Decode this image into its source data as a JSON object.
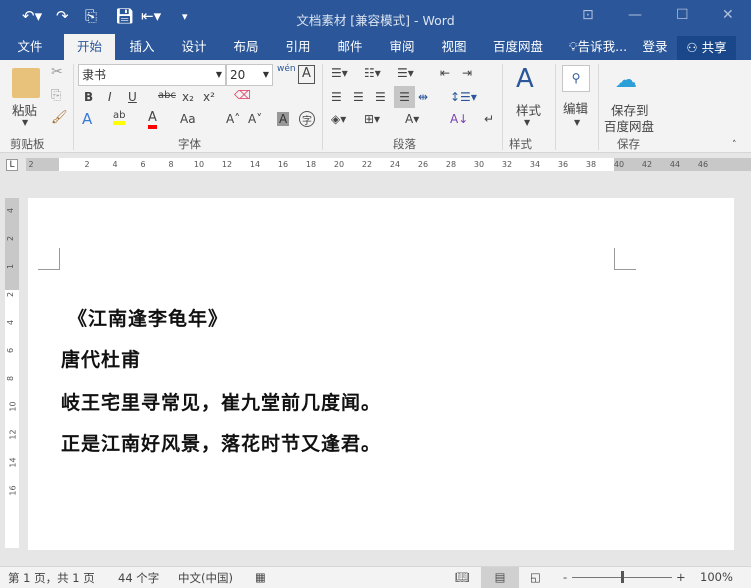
{
  "titlebar": {
    "title": "文档素材 [兼容模式] - Word"
  },
  "tabs": [
    "文件",
    "开始",
    "插入",
    "设计",
    "布局",
    "引用",
    "邮件",
    "审阅",
    "视图",
    "百度网盘"
  ],
  "tell_me": "告诉我...",
  "login": "登录",
  "share": "共享",
  "ribbon": {
    "paste": "粘贴",
    "clipboard": "剪贴板",
    "font_name": "隶书",
    "font_size": "20",
    "font_group": "字体",
    "paragraph_group": "段落",
    "styles": "样式",
    "styles_group": "样式",
    "edit": "编辑",
    "save_to": "保存到",
    "baidu": "百度网盘",
    "save_group": "保存",
    "bold": "B",
    "italic": "I",
    "underline": "U",
    "strike": "abc",
    "sub": "x₂",
    "sup": "x²",
    "aa": "Aa",
    "pinyin": "wén",
    "char": "字"
  },
  "colors": {
    "highlight": "#ffff00",
    "font_color": "#ff0000",
    "accent": "#2b579a"
  },
  "ruler": {
    "marks": [
      "2",
      "2",
      "4",
      "6",
      "8",
      "10",
      "12",
      "14",
      "16",
      "18",
      "20",
      "22",
      "24",
      "26",
      "28",
      "30",
      "32",
      "34",
      "36",
      "38",
      "40",
      "42",
      "44",
      "46"
    ]
  },
  "vruler": {
    "marks": [
      "4",
      "2",
      "1",
      "2",
      "4",
      "6",
      "8",
      "10",
      "12",
      "14",
      "16"
    ]
  },
  "document": {
    "lines": [
      "《江南逢李龟年》",
      "唐代杜甫",
      "岐王宅里寻常见，崔九堂前几度闻。",
      "正是江南好风景，落花时节又逢君。"
    ]
  },
  "status": {
    "page": "第 1 页，共 1 页",
    "words": "44 个字",
    "lang": "中文(中国)",
    "zoom": "100%",
    "zoom_level": 100
  }
}
